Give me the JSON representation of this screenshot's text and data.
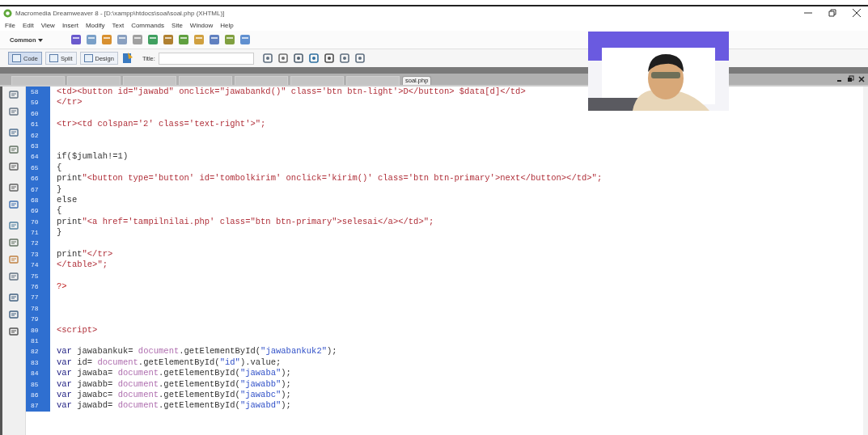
{
  "window": {
    "title": "Macromedia Dreamweaver 8 - [D:\\xampp\\htdocs\\soal\\soal.php (XHTML)]"
  },
  "menu": [
    "File",
    "Edit",
    "View",
    "Insert",
    "Modify",
    "Text",
    "Commands",
    "Site",
    "Window",
    "Help"
  ],
  "insert_bar": {
    "category": "Common"
  },
  "document_toolbar": {
    "views": [
      {
        "label": "Code",
        "selected": true
      },
      {
        "label": "Split",
        "selected": false
      },
      {
        "label": "Design",
        "selected": false
      }
    ],
    "title_label": "Title:"
  },
  "tabs": [
    {
      "selected": false
    },
    {
      "selected": false
    },
    {
      "selected": false
    },
    {
      "selected": false
    },
    {
      "selected": false
    },
    {
      "selected": false
    },
    {
      "selected": false
    },
    {
      "label": "soal.php",
      "selected": true
    }
  ],
  "code_lines": [
    {
      "number": "58",
      "segments": [
        {
          "kind": "tag",
          "text": "<td><button id=\"jawabd\" onclick=\"jawabankd()\" class='btn btn-light'>D</button> $data[d]</td>"
        }
      ]
    },
    {
      "number": "59",
      "segments": [
        {
          "kind": "tag",
          "text": "</tr>"
        }
      ]
    },
    {
      "number": "60"
    },
    {
      "number": "61",
      "segments": [
        {
          "kind": "tag",
          "text": "<tr><td colspan='2' class='text-right'>\";"
        }
      ]
    },
    {
      "number": "62"
    },
    {
      "number": "63"
    },
    {
      "number": "64",
      "segments": [
        {
          "kind": "plain",
          "text": "if($jumlah!=1)"
        }
      ]
    },
    {
      "number": "65",
      "segments": [
        {
          "kind": "plain",
          "text": "{"
        }
      ]
    },
    {
      "number": "66",
      "segments": [
        {
          "kind": "plain",
          "text": "print"
        },
        {
          "kind": "tag",
          "text": "\"<button type='button' id='tombolkirim' onclick='kirim()' class='btn btn-primary'>next</button></td>\";"
        }
      ]
    },
    {
      "number": "67",
      "segments": [
        {
          "kind": "plain",
          "text": "}"
        }
      ]
    },
    {
      "number": "68",
      "segments": [
        {
          "kind": "plain",
          "text": "else"
        }
      ]
    },
    {
      "number": "69",
      "segments": [
        {
          "kind": "plain",
          "text": "{"
        }
      ]
    },
    {
      "number": "70",
      "segments": [
        {
          "kind": "plain",
          "text": "print"
        },
        {
          "kind": "tag",
          "text": "\"<a href='tampilnilai.php' class=\"btn btn-primary\">selesai</a></td>\";"
        }
      ]
    },
    {
      "number": "71",
      "segments": [
        {
          "kind": "plain",
          "text": "}"
        }
      ]
    },
    {
      "number": "72"
    },
    {
      "number": "73",
      "segments": [
        {
          "kind": "plain",
          "text": "print"
        },
        {
          "kind": "tag",
          "text": "\"</tr>"
        }
      ]
    },
    {
      "number": "74",
      "segments": [
        {
          "kind": "tag",
          "text": "</table>\";"
        }
      ]
    },
    {
      "number": "75"
    },
    {
      "number": "76",
      "segments": [
        {
          "kind": "php",
          "text": "?>"
        }
      ]
    },
    {
      "number": "77"
    },
    {
      "number": "78"
    },
    {
      "number": "79"
    },
    {
      "number": "80",
      "segments": [
        {
          "kind": "tag",
          "text": "<script>"
        }
      ]
    },
    {
      "number": "81"
    },
    {
      "number": "82",
      "segments": [
        {
          "kind": "keyword",
          "text": "var"
        },
        {
          "kind": "plain",
          "text": " jawabankuk= "
        },
        {
          "kind": "object",
          "text": "document"
        },
        {
          "kind": "plain",
          "text": ".getElementById("
        },
        {
          "kind": "string",
          "text": "\"jawabankuk2\""
        },
        {
          "kind": "plain",
          "text": ");"
        }
      ]
    },
    {
      "number": "83",
      "segments": [
        {
          "kind": "keyword",
          "text": "var"
        },
        {
          "kind": "plain",
          "text": " id= "
        },
        {
          "kind": "object",
          "text": "document"
        },
        {
          "kind": "plain",
          "text": ".getElementById("
        },
        {
          "kind": "string",
          "text": "\"id\""
        },
        {
          "kind": "plain",
          "text": ").value;"
        }
      ]
    },
    {
      "number": "84",
      "segments": [
        {
          "kind": "keyword",
          "text": "var"
        },
        {
          "kind": "plain",
          "text": " jawaba= "
        },
        {
          "kind": "object",
          "text": "document"
        },
        {
          "kind": "plain",
          "text": ".getElementById("
        },
        {
          "kind": "string",
          "text": "\"jawaba\""
        },
        {
          "kind": "plain",
          "text": ");"
        }
      ]
    },
    {
      "number": "85",
      "segments": [
        {
          "kind": "keyword",
          "text": "var"
        },
        {
          "kind": "plain",
          "text": " jawabb= "
        },
        {
          "kind": "object",
          "text": "document"
        },
        {
          "kind": "plain",
          "text": ".getElementById("
        },
        {
          "kind": "string",
          "text": "\"jawabb\""
        },
        {
          "kind": "plain",
          "text": ");"
        }
      ]
    },
    {
      "number": "86",
      "segments": [
        {
          "kind": "keyword",
          "text": "var"
        },
        {
          "kind": "plain",
          "text": " jawabc= "
        },
        {
          "kind": "object",
          "text": "document"
        },
        {
          "kind": "plain",
          "text": ".getElementById("
        },
        {
          "kind": "string",
          "text": "\"jawabc\""
        },
        {
          "kind": "plain",
          "text": ");"
        }
      ]
    },
    {
      "number": "87",
      "segments": [
        {
          "kind": "keyword",
          "text": "var"
        },
        {
          "kind": "plain",
          "text": " jawabd= "
        },
        {
          "kind": "object",
          "text": "document"
        },
        {
          "kind": "plain",
          "text": ".getElementById("
        },
        {
          "kind": "string",
          "text": "\"jawabd\""
        },
        {
          "kind": "plain",
          "text": ");"
        }
      ]
    }
  ]
}
